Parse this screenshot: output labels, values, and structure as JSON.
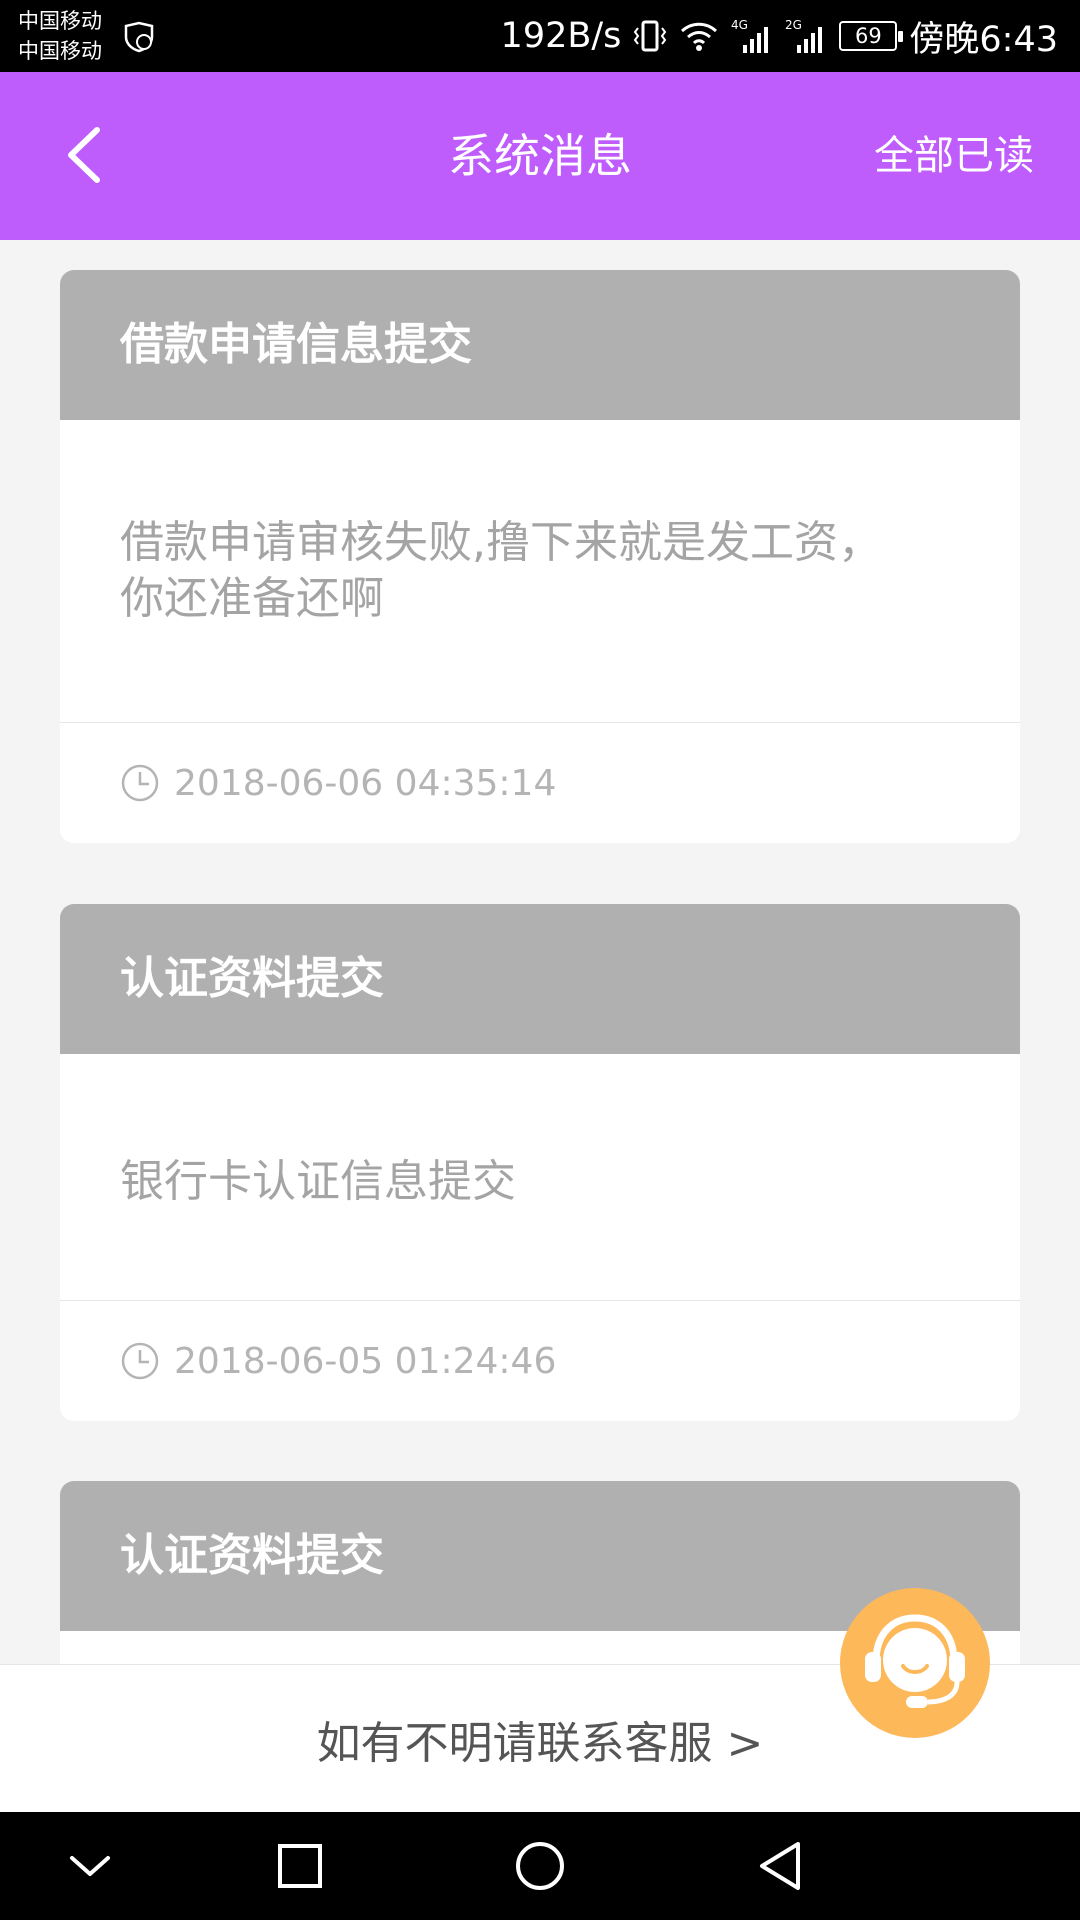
{
  "status_bar": {
    "carrier1": "中国移动",
    "carrier2": "中国移动",
    "speed": "192B/s",
    "net1": "4G",
    "net2": "2G",
    "battery": "69",
    "time": "傍晚6:43"
  },
  "header": {
    "title": "系统消息",
    "action": "全部已读"
  },
  "messages": [
    {
      "title": "借款申请信息提交",
      "body_line1": "借款申请审核失败,撸下来就是发工资，",
      "body_line2": "你还准备还啊",
      "time": "2018-06-06 04:35:14"
    },
    {
      "title": "认证资料提交",
      "body_line1": "银行卡认证信息提交",
      "time": "2018-06-05 01:24:46"
    },
    {
      "title": "认证资料提交"
    }
  ],
  "footer": {
    "contact_text": "如有不明请联系客服 >"
  },
  "colors": {
    "header_bg": "#bf5cfc",
    "card_header_bg": "#b0b0b0",
    "cs_button_bg": "#fdb85a"
  },
  "icons": {
    "back": "back-arrow-icon",
    "clock": "clock-icon",
    "customer_service": "headset-icon"
  }
}
